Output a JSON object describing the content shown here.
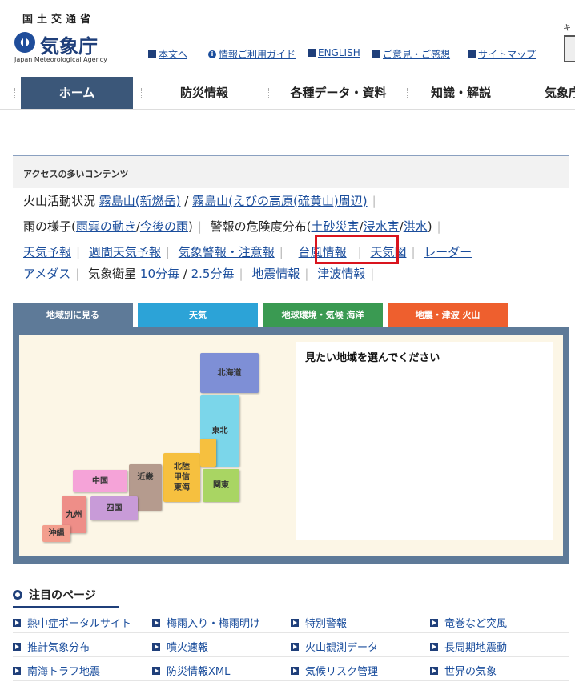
{
  "header": {
    "logo_top": "国土交通省",
    "logo_name": "気象庁",
    "logo_en": "Japan Meteorological Agency",
    "right_stub": "キ",
    "util_links": [
      "本文へ",
      "情報ご利用ガイド",
      "ENGLISH",
      "ご意見・ご感想",
      "サイトマップ"
    ]
  },
  "nav": {
    "items": [
      "ホーム",
      "防災情報",
      "各種データ・資料",
      "知識・解説",
      "気象庁"
    ]
  },
  "access": {
    "heading": "アクセスの多いコンテンツ",
    "line1": {
      "label": "火山活動状況",
      "link1": "霧島山(新燃岳)",
      "sep": "/",
      "link2": "霧島山(えびの高原(硫黄山)周辺)"
    },
    "line2": {
      "label": "雨の様子(",
      "link1": "雨雲の動き",
      "sep1": "/",
      "link2": "今後の雨",
      "close1": ")",
      "label2": "警報の危険度分布(",
      "link3": "土砂災害",
      "sep2": "/",
      "link4": "浸水害",
      "sep3": "/",
      "link5": "洪水",
      "close2": ")"
    },
    "line3": {
      "link1": "天気予報",
      "link2": "週間天気予報",
      "link3": "気象警報・注意報",
      "link4": "台風情報",
      "link5": "天気図",
      "link6": "レーダー"
    },
    "line4": {
      "link1": "アメダス",
      "label": "気象衛星",
      "link2": "10分毎",
      "sep": "/",
      "link3": "2.5分毎",
      "link4": "地震情報",
      "link5": "津波情報"
    }
  },
  "tabs": [
    {
      "label": "地域別に見る",
      "color": "#5e7a98"
    },
    {
      "label": "天気",
      "color": "#2ca3d7"
    },
    {
      "label": "地球環境・気候 海洋",
      "color": "#3a9a52"
    },
    {
      "label": "地震・津波 火山",
      "color": "#ee5f2e"
    }
  ],
  "map": {
    "instruction": "見たい地域を選んでください",
    "regions": [
      {
        "label": "北海道",
        "color": "#7e8fd6"
      },
      {
        "label": "東北",
        "color": "#7bd6ea"
      },
      {
        "label": "関東",
        "color": "#a9d563"
      },
      {
        "label": "北陸\n甲信\n東海",
        "color": "#f6c03f"
      },
      {
        "label": "近畿",
        "color": "#b59b8e"
      },
      {
        "label": "中国",
        "color": "#f5a3d8"
      },
      {
        "label": "四国",
        "color": "#c89bd8"
      },
      {
        "label": "九州",
        "color": "#ee8e88"
      },
      {
        "label": "沖縄",
        "color": "#f39e8d"
      }
    ]
  },
  "attention": {
    "title": "注目のページ",
    "items": [
      "熱中症ポータルサイト",
      "梅雨入り・梅雨明け",
      "特別警報",
      "竜巻など突風",
      "推計気象分布",
      "噴火速報",
      "火山観測データ",
      "長周期地震動",
      "南海トラフ地震",
      "防災情報XML",
      "気候リスク管理",
      "世界の気象"
    ]
  },
  "colors": {
    "nav_active": "#3b5779",
    "link": "#1a4d9c",
    "highlight": "#d9141e"
  }
}
